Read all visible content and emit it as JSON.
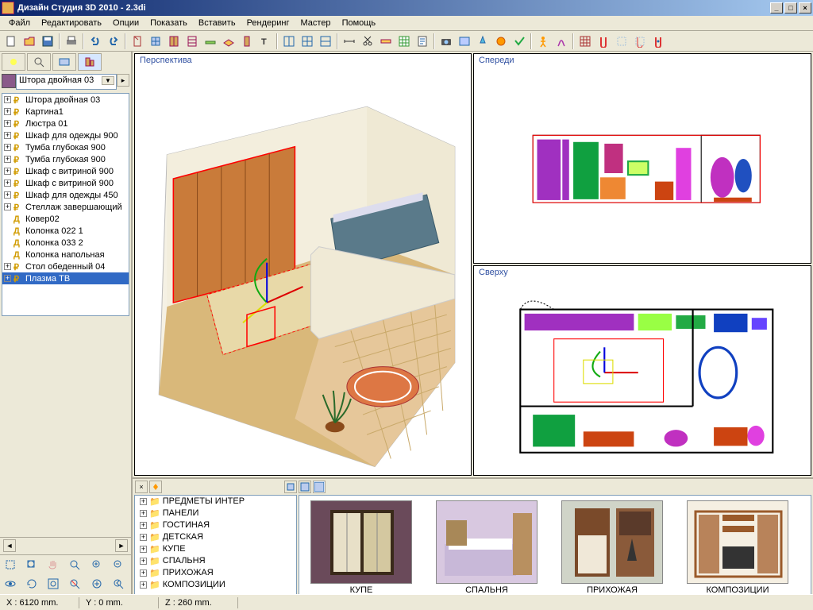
{
  "window": {
    "title": "Дизайн Студия 3D 2010 - 2.3di"
  },
  "menu": [
    "Файл",
    "Редактировать",
    "Опции",
    "Показать",
    "Вставить",
    "Рендеринг",
    "Мастер",
    "Помощь"
  ],
  "combo": {
    "value": "Штора двойная 03"
  },
  "scene_tree": [
    {
      "label": "Штора двойная 03",
      "type": "P",
      "exp": true
    },
    {
      "label": "Картина1",
      "type": "P",
      "exp": true
    },
    {
      "label": "Люстра 01",
      "type": "P",
      "exp": true
    },
    {
      "label": "Шкаф для одежды 900",
      "type": "P",
      "exp": true
    },
    {
      "label": "Тумба глубокая 900",
      "type": "P",
      "exp": true
    },
    {
      "label": "Тумба глубокая 900",
      "type": "P",
      "exp": true
    },
    {
      "label": "Шкаф с витриной 900",
      "type": "P",
      "exp": true
    },
    {
      "label": "Шкаф с витриной 900",
      "type": "P",
      "exp": true
    },
    {
      "label": "Шкаф для одежды 450",
      "type": "P",
      "exp": true
    },
    {
      "label": "Стеллаж завершающий",
      "type": "P",
      "exp": true
    },
    {
      "label": "Ковер02",
      "type": "Д",
      "exp": false
    },
    {
      "label": "Колонка 022 1",
      "type": "Д",
      "exp": false
    },
    {
      "label": "Колонка 033 2",
      "type": "Д",
      "exp": false
    },
    {
      "label": "Колонка напольная",
      "type": "Д",
      "exp": false
    },
    {
      "label": "Стол обеденный 04",
      "type": "P",
      "exp": true
    },
    {
      "label": "Плазма ТВ",
      "type": "P",
      "exp": true,
      "sel": true
    }
  ],
  "viewports": {
    "persp": "Перспектива",
    "front": "Спереди",
    "top": "Сверху"
  },
  "catalog_tree": [
    {
      "label": "ПРЕДМЕТЫ ИНТЕР",
      "exp": true
    },
    {
      "label": "ПАНЕЛИ",
      "exp": true
    },
    {
      "label": "ГОСТИНАЯ",
      "exp": true
    },
    {
      "label": "ДЕТСКАЯ",
      "exp": true
    },
    {
      "label": "КУПЕ",
      "exp": true
    },
    {
      "label": "СПАЛЬНЯ",
      "exp": true
    },
    {
      "label": "ПРИХОЖАЯ",
      "exp": true
    },
    {
      "label": "КОМПОЗИЦИИ",
      "exp": true
    }
  ],
  "thumbs": [
    {
      "label": "КУПЕ"
    },
    {
      "label": "СПАЛЬНЯ"
    },
    {
      "label": "ПРИХОЖАЯ"
    },
    {
      "label": "КОМПОЗИЦИИ"
    }
  ],
  "status": {
    "x": "X : 6120 mm.",
    "y": "Y : 0 mm.",
    "z": "Z : 260 mm."
  }
}
